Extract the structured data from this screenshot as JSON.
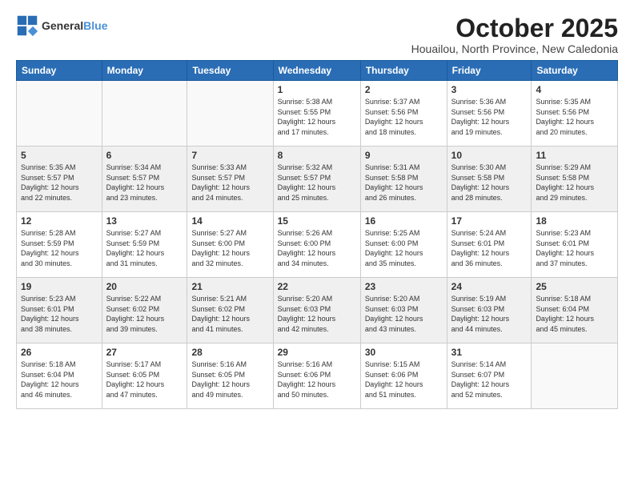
{
  "logo": {
    "general": "General",
    "blue": "Blue"
  },
  "title": "October 2025",
  "location": "Houailou, North Province, New Caledonia",
  "days_of_week": [
    "Sunday",
    "Monday",
    "Tuesday",
    "Wednesday",
    "Thursday",
    "Friday",
    "Saturday"
  ],
  "weeks": [
    [
      {
        "day": "",
        "info": ""
      },
      {
        "day": "",
        "info": ""
      },
      {
        "day": "",
        "info": ""
      },
      {
        "day": "1",
        "info": "Sunrise: 5:38 AM\nSunset: 5:55 PM\nDaylight: 12 hours\nand 17 minutes."
      },
      {
        "day": "2",
        "info": "Sunrise: 5:37 AM\nSunset: 5:56 PM\nDaylight: 12 hours\nand 18 minutes."
      },
      {
        "day": "3",
        "info": "Sunrise: 5:36 AM\nSunset: 5:56 PM\nDaylight: 12 hours\nand 19 minutes."
      },
      {
        "day": "4",
        "info": "Sunrise: 5:35 AM\nSunset: 5:56 PM\nDaylight: 12 hours\nand 20 minutes."
      }
    ],
    [
      {
        "day": "5",
        "info": "Sunrise: 5:35 AM\nSunset: 5:57 PM\nDaylight: 12 hours\nand 22 minutes."
      },
      {
        "day": "6",
        "info": "Sunrise: 5:34 AM\nSunset: 5:57 PM\nDaylight: 12 hours\nand 23 minutes."
      },
      {
        "day": "7",
        "info": "Sunrise: 5:33 AM\nSunset: 5:57 PM\nDaylight: 12 hours\nand 24 minutes."
      },
      {
        "day": "8",
        "info": "Sunrise: 5:32 AM\nSunset: 5:57 PM\nDaylight: 12 hours\nand 25 minutes."
      },
      {
        "day": "9",
        "info": "Sunrise: 5:31 AM\nSunset: 5:58 PM\nDaylight: 12 hours\nand 26 minutes."
      },
      {
        "day": "10",
        "info": "Sunrise: 5:30 AM\nSunset: 5:58 PM\nDaylight: 12 hours\nand 28 minutes."
      },
      {
        "day": "11",
        "info": "Sunrise: 5:29 AM\nSunset: 5:58 PM\nDaylight: 12 hours\nand 29 minutes."
      }
    ],
    [
      {
        "day": "12",
        "info": "Sunrise: 5:28 AM\nSunset: 5:59 PM\nDaylight: 12 hours\nand 30 minutes."
      },
      {
        "day": "13",
        "info": "Sunrise: 5:27 AM\nSunset: 5:59 PM\nDaylight: 12 hours\nand 31 minutes."
      },
      {
        "day": "14",
        "info": "Sunrise: 5:27 AM\nSunset: 6:00 PM\nDaylight: 12 hours\nand 32 minutes."
      },
      {
        "day": "15",
        "info": "Sunrise: 5:26 AM\nSunset: 6:00 PM\nDaylight: 12 hours\nand 34 minutes."
      },
      {
        "day": "16",
        "info": "Sunrise: 5:25 AM\nSunset: 6:00 PM\nDaylight: 12 hours\nand 35 minutes."
      },
      {
        "day": "17",
        "info": "Sunrise: 5:24 AM\nSunset: 6:01 PM\nDaylight: 12 hours\nand 36 minutes."
      },
      {
        "day": "18",
        "info": "Sunrise: 5:23 AM\nSunset: 6:01 PM\nDaylight: 12 hours\nand 37 minutes."
      }
    ],
    [
      {
        "day": "19",
        "info": "Sunrise: 5:23 AM\nSunset: 6:01 PM\nDaylight: 12 hours\nand 38 minutes."
      },
      {
        "day": "20",
        "info": "Sunrise: 5:22 AM\nSunset: 6:02 PM\nDaylight: 12 hours\nand 39 minutes."
      },
      {
        "day": "21",
        "info": "Sunrise: 5:21 AM\nSunset: 6:02 PM\nDaylight: 12 hours\nand 41 minutes."
      },
      {
        "day": "22",
        "info": "Sunrise: 5:20 AM\nSunset: 6:03 PM\nDaylight: 12 hours\nand 42 minutes."
      },
      {
        "day": "23",
        "info": "Sunrise: 5:20 AM\nSunset: 6:03 PM\nDaylight: 12 hours\nand 43 minutes."
      },
      {
        "day": "24",
        "info": "Sunrise: 5:19 AM\nSunset: 6:03 PM\nDaylight: 12 hours\nand 44 minutes."
      },
      {
        "day": "25",
        "info": "Sunrise: 5:18 AM\nSunset: 6:04 PM\nDaylight: 12 hours\nand 45 minutes."
      }
    ],
    [
      {
        "day": "26",
        "info": "Sunrise: 5:18 AM\nSunset: 6:04 PM\nDaylight: 12 hours\nand 46 minutes."
      },
      {
        "day": "27",
        "info": "Sunrise: 5:17 AM\nSunset: 6:05 PM\nDaylight: 12 hours\nand 47 minutes."
      },
      {
        "day": "28",
        "info": "Sunrise: 5:16 AM\nSunset: 6:05 PM\nDaylight: 12 hours\nand 49 minutes."
      },
      {
        "day": "29",
        "info": "Sunrise: 5:16 AM\nSunset: 6:06 PM\nDaylight: 12 hours\nand 50 minutes."
      },
      {
        "day": "30",
        "info": "Sunrise: 5:15 AM\nSunset: 6:06 PM\nDaylight: 12 hours\nand 51 minutes."
      },
      {
        "day": "31",
        "info": "Sunrise: 5:14 AM\nSunset: 6:07 PM\nDaylight: 12 hours\nand 52 minutes."
      },
      {
        "day": "",
        "info": ""
      }
    ]
  ]
}
